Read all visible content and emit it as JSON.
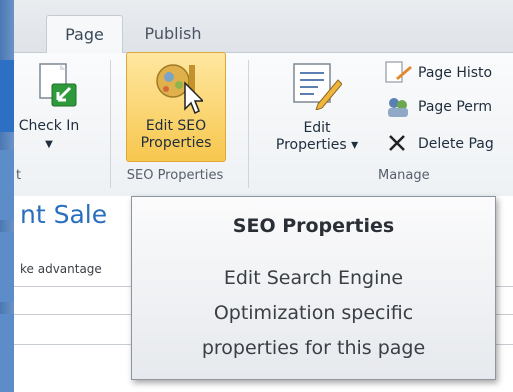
{
  "tabs": [
    {
      "label": "Page"
    },
    {
      "label": "Publish"
    }
  ],
  "ribbon": {
    "check_in_label": "Check In",
    "left_group_label": "t",
    "seo_button_label_line1": "Edit SEO",
    "seo_button_label_line2": "Properties",
    "seo_group_label": "SEO Properties",
    "edit_properties_line1": "Edit",
    "edit_properties_line2": "Properties ▾",
    "manage_items": [
      {
        "label": "Page Histo"
      },
      {
        "label": "Page Perm"
      },
      {
        "label": "Delete Pag"
      }
    ],
    "manage_group_label": "Manage"
  },
  "content": {
    "heading_fragment": "nt Sale",
    "body_fragment": "ke advantage"
  },
  "tooltip": {
    "title": "SEO Properties",
    "lines": [
      "Edit Search Engine",
      "Optimization specific",
      "properties for this page"
    ]
  },
  "colors": {
    "accent_blue": "#2d6fc2",
    "seo_highlight": "#f7c74e",
    "heading_blue": "#2a6fbf"
  }
}
